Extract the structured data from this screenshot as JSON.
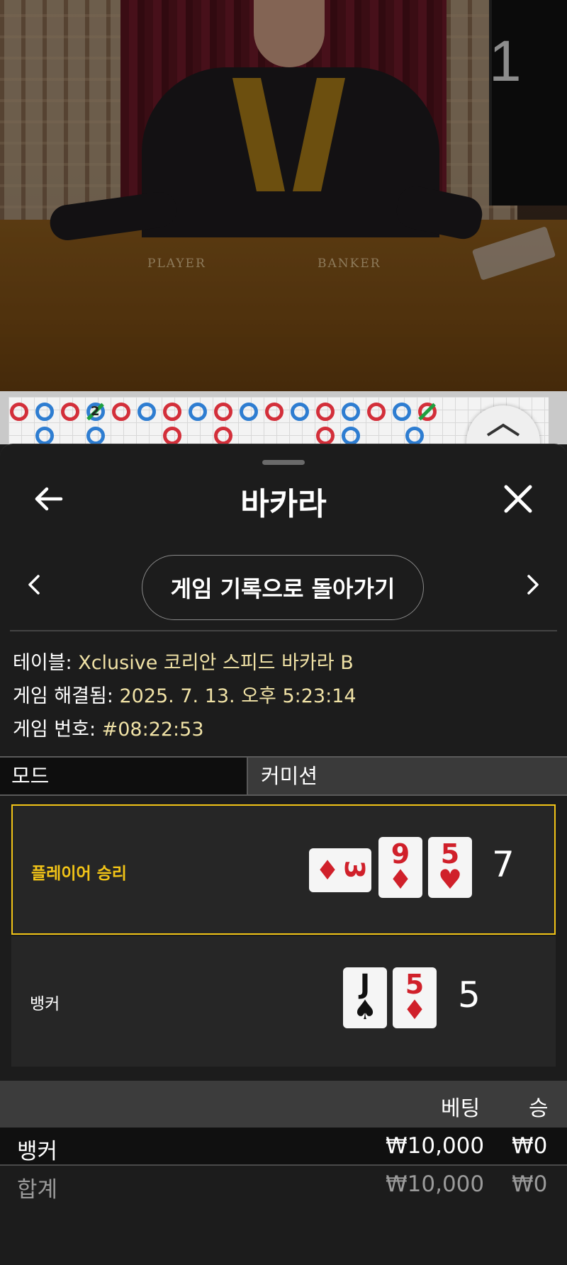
{
  "video": {
    "monitor_digit": "1",
    "table_labels": {
      "player": "PLAYER",
      "banker": "BANKER"
    }
  },
  "road": {
    "marker_numbers": [
      "2"
    ]
  },
  "header": {
    "title": "바카라",
    "back_icon": "arrow-left-icon",
    "close_icon": "close-icon"
  },
  "history_nav": {
    "back_to_history_label": "게임 기록으로 돌아가기",
    "prev_icon": "chevron-left-icon",
    "next_icon": "chevron-right-icon"
  },
  "game_info": {
    "table_label": "테이블: ",
    "table_value": "Xclusive 코리안 스피드 바카라 B",
    "resolved_label": "게임 해결됨: ",
    "resolved_value": "2025. 7. 13. 오후 5:23:14",
    "number_label": "게임 번호: ",
    "number_value": "#08:22:53"
  },
  "tabs": {
    "mode": "모드",
    "commission": "커미션"
  },
  "hands": {
    "player": {
      "label": "플레이어 승리",
      "score": "7",
      "cards": [
        {
          "rank": "3",
          "suit": "♦",
          "color": "red",
          "rotated": true
        },
        {
          "rank": "9",
          "suit": "♦",
          "color": "red",
          "rotated": false
        },
        {
          "rank": "5",
          "suit": "♥",
          "color": "red",
          "rotated": false
        }
      ]
    },
    "banker": {
      "label": "뱅커",
      "score": "5",
      "cards": [
        {
          "rank": "J",
          "suit": "♠",
          "color": "black",
          "rotated": false
        },
        {
          "rank": "5",
          "suit": "♦",
          "color": "red",
          "rotated": false
        }
      ]
    }
  },
  "bets": {
    "headers": {
      "bet": "베팅",
      "win": "승"
    },
    "rows": [
      {
        "name": "뱅커",
        "bet": "₩10,000",
        "win": "₩0"
      }
    ],
    "total": {
      "name": "합계",
      "bet": "₩10,000",
      "win": "₩0"
    }
  },
  "colors": {
    "accent_gold": "#f2c417",
    "info_value": "#f0e2a6",
    "road_red": "#d32f3a",
    "road_blue": "#2e7dd1",
    "card_red": "#d0202a"
  }
}
